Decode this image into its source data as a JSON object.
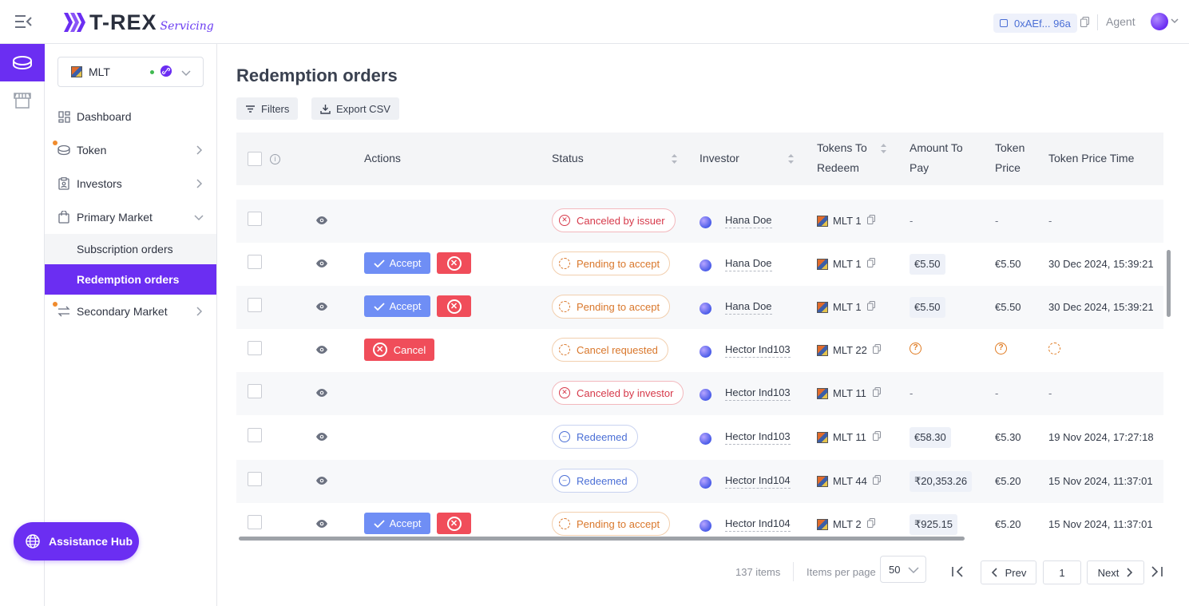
{
  "brand": {
    "name": "T-REX",
    "sub": "Servicing",
    "accent": "#6b2ef2"
  },
  "header": {
    "wallet": "0xAEf... 96a",
    "role": "Agent"
  },
  "sidebar": {
    "asset": "MLT",
    "items": [
      {
        "label": "Dashboard"
      },
      {
        "label": "Token"
      },
      {
        "label": "Investors"
      },
      {
        "label": "Primary Market"
      },
      {
        "label": "Secondary Market"
      }
    ],
    "sub_items": [
      {
        "label": "Subscription orders"
      },
      {
        "label": "Redemption orders"
      }
    ],
    "assist": "Assistance Hub"
  },
  "main": {
    "title": "Redemption orders",
    "filters": "Filters",
    "export": "Export CSV"
  },
  "table": {
    "headers": {
      "actions": "Actions",
      "status": "Status",
      "investor": "Investor",
      "tokens_l1": "Tokens To",
      "tokens_l2": "Redeem",
      "amount_l1": "Amount To",
      "amount_l2": "Pay",
      "price_l1": "Token",
      "price_l2": "Price",
      "time": "Token Price Time"
    },
    "accept_label": "Accept",
    "cancel_label": "Cancel",
    "dash": "-",
    "rows": [
      {
        "status": "Canceled by issuer",
        "investor": "Hana Doe",
        "tokens": "MLT 1",
        "amount": "-",
        "price": "-",
        "time": "-"
      },
      {
        "status": "Pending to accept",
        "investor": "Hana Doe",
        "tokens": "MLT 1",
        "amount": "€5.50",
        "price": "€5.50",
        "time": "30 Dec 2024, 15:39:21"
      },
      {
        "status": "Pending to accept",
        "investor": "Hana Doe",
        "tokens": "MLT 1",
        "amount": "€5.50",
        "price": "€5.50",
        "time": "30 Dec 2024, 15:39:21"
      },
      {
        "status": "Cancel requested",
        "investor": "Hector Ind103",
        "tokens": "MLT 22"
      },
      {
        "status": "Canceled by investor",
        "investor": "Hector Ind103",
        "tokens": "MLT 11",
        "amount": "-",
        "price": "-",
        "time": "-"
      },
      {
        "status": "Redeemed",
        "investor": "Hector Ind103",
        "tokens": "MLT 11",
        "amount": "€58.30",
        "price": "€5.30",
        "time": "19 Nov 2024, 17:27:18"
      },
      {
        "status": "Redeemed",
        "investor": "Hector Ind104",
        "tokens": "MLT 44",
        "amount": "₹20,353.26",
        "price": "€5.20",
        "time": "15 Nov 2024, 11:37:01"
      },
      {
        "status": "Pending to accept",
        "investor": "Hector Ind104",
        "tokens": "MLT 2",
        "amount": "₹925.15",
        "price": "€5.20",
        "time": "15 Nov 2024, 11:37:01"
      }
    ]
  },
  "pagination": {
    "total": "137 items",
    "per_page_label": "Items per page",
    "per_page": "50",
    "prev": "Prev",
    "page": "1",
    "next": "Next"
  }
}
